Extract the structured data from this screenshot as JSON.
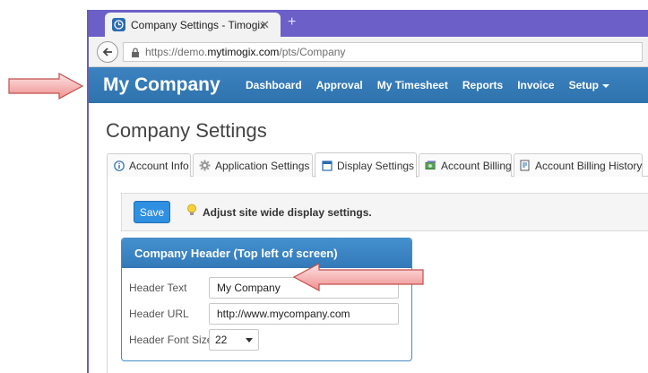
{
  "browser": {
    "tab_title": "Company Settings - Timogix",
    "url_prefix": "https://demo.",
    "url_domain": "mytimogix.com",
    "url_path": "/pts/Company"
  },
  "navbar": {
    "brand": "My Company",
    "items": [
      {
        "label": "Dashboard"
      },
      {
        "label": "Approval"
      },
      {
        "label": "My Timesheet"
      },
      {
        "label": "Reports"
      },
      {
        "label": "Invoice"
      },
      {
        "label": "Setup"
      }
    ],
    "color": "#337ab7"
  },
  "page": {
    "title": "Company Settings",
    "tabs": [
      {
        "label": "Account Info",
        "icon": "info-icon"
      },
      {
        "label": "Application Settings",
        "icon": "gear-icon"
      },
      {
        "label": "Display Settings",
        "icon": "display-icon",
        "active": true
      },
      {
        "label": "Account Billing",
        "icon": "billing-icon"
      },
      {
        "label": "Account Billing History",
        "icon": "history-icon"
      }
    ],
    "toolbar": {
      "save_label": "Save",
      "hint": "Adjust site wide display settings."
    },
    "header_box": {
      "title": "Company Header (Top left of screen)",
      "header_text_label": "Header Text",
      "header_text_value": "My Company",
      "header_url_label": "Header URL",
      "header_url_value": "http://www.mycompany.com",
      "font_size_label": "Header Font Size",
      "font_size_value": "22"
    }
  },
  "annotation_color": "#f4a6a6"
}
